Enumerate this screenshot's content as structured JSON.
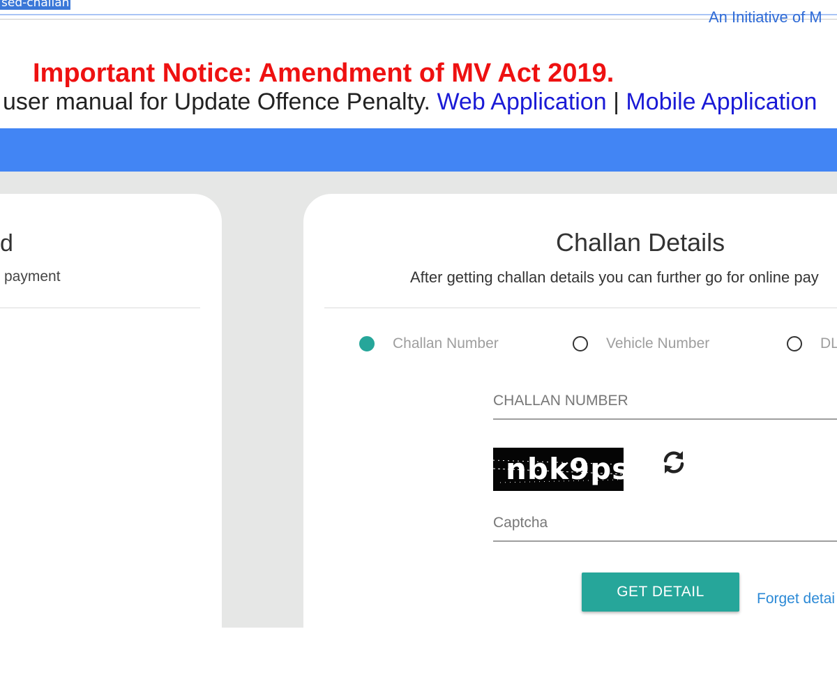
{
  "browser": {
    "url_fragment": "sed-challan"
  },
  "header": {
    "initiative": "An Initiative of M",
    "notice": "Important Notice: Amendment of MV Act 2019.",
    "manual_text": "user manual for Update Offence Penalty. ",
    "web_link": "Web Application",
    "separator": " | ",
    "mobile_link": "Mobile Application"
  },
  "left_card": {
    "title": "d",
    "subtitle": "payment"
  },
  "challan_card": {
    "title": "Challan Details",
    "subtitle": "After getting challan details you can further go for online pay",
    "search_options": [
      {
        "label": "Challan Number",
        "checked": true
      },
      {
        "label": "Vehicle Number",
        "checked": false
      },
      {
        "label": "DL",
        "checked": false
      }
    ],
    "challan_field": {
      "placeholder": "CHALLAN NUMBER",
      "value": ""
    },
    "captcha_text": "nbk9ps",
    "captcha_field": {
      "placeholder": "Captcha",
      "value": ""
    },
    "submit_label": "GET DETAIL",
    "forgot_link": "Forget detai"
  },
  "colors": {
    "accent_teal": "#26a69a",
    "blue_bar": "#4285f4",
    "notice_red": "#ee1111",
    "link_blue": "#1a1ad6"
  }
}
